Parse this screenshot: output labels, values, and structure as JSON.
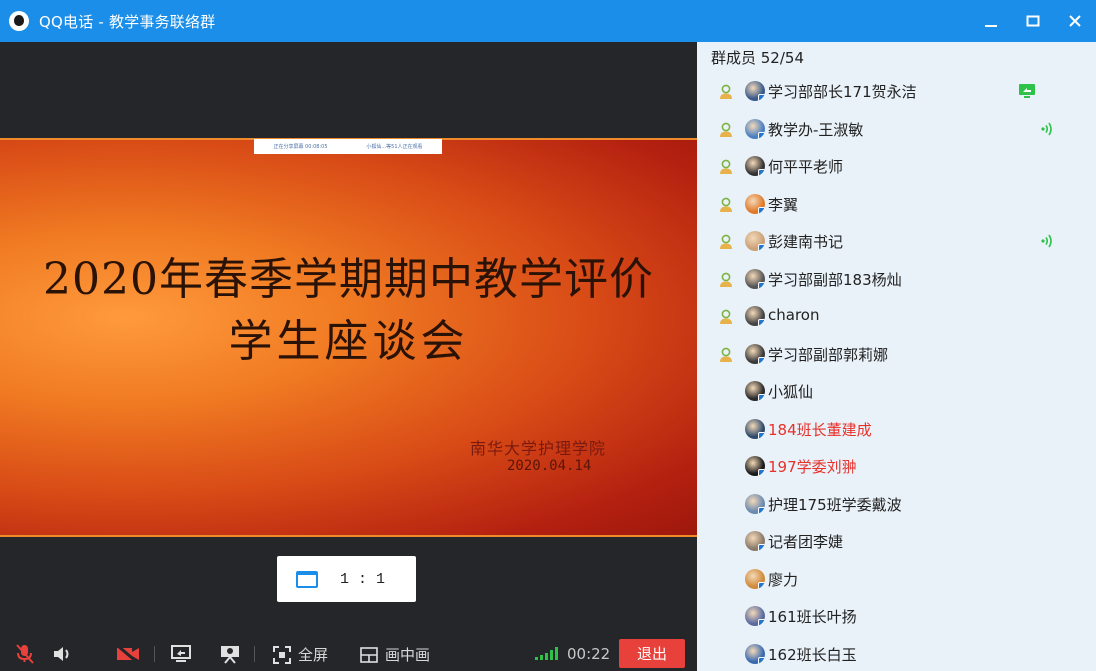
{
  "window": {
    "title": "QQ电话 - 教学事务联络群",
    "minimize_icon": "minimize-icon",
    "maximize_icon": "maximize-icon",
    "close_icon": "close-icon"
  },
  "slide": {
    "share_bar_left": "正在分享屏幕 00:08:05",
    "share_bar_right": "小狐仙...等51人正在观看",
    "title": "2020年春季学期期中教学评价",
    "subtitle": "学生座谈会",
    "org": "南华大学护理学院",
    "date": "2020.04.14"
  },
  "view_ratio": {
    "label": "1 : 1",
    "icon": "window-icon"
  },
  "controls": {
    "mic_icon": "mic-muted-icon",
    "speaker_icon": "speaker-icon",
    "camera_icon": "camera-off-icon",
    "share_screen_icon": "share-screen-icon",
    "presenter_icon": "presenter-icon",
    "fullscreen_label": "全屏",
    "pip_label": "画中画",
    "timer": "00:22",
    "exit_label": "退出",
    "signal_color": "#2fc24a"
  },
  "members": {
    "header": "群成员 52/54",
    "list": [
      {
        "name": "学习部部长171贺永洁",
        "red": false,
        "role_icon": true,
        "right_icon": "sharing-screen-icon",
        "avatar_color": "#3a5a8a"
      },
      {
        "name": "教学办-王淑敏",
        "red": false,
        "role_icon": true,
        "right_icon": "speaking-icon",
        "avatar_color": "#4a7fc0"
      },
      {
        "name": "何平平老师",
        "red": false,
        "role_icon": true,
        "right_icon": "",
        "avatar_color": "#333333"
      },
      {
        "name": "李翼",
        "red": false,
        "role_icon": true,
        "right_icon": "",
        "avatar_color": "#e07a2a"
      },
      {
        "name": "彭建南书记",
        "red": false,
        "role_icon": true,
        "right_icon": "speaking-icon",
        "avatar_color": "#caa27a"
      },
      {
        "name": "学习部副部183杨灿",
        "red": false,
        "role_icon": true,
        "right_icon": "",
        "avatar_color": "#555555"
      },
      {
        "name": "charon",
        "red": false,
        "role_icon": true,
        "right_icon": "",
        "avatar_color": "#444444"
      },
      {
        "name": "学习部副部郭莉娜",
        "red": false,
        "role_icon": true,
        "right_icon": "",
        "avatar_color": "#3a3a3a"
      },
      {
        "name": "小狐仙",
        "red": false,
        "role_icon": false,
        "right_icon": "",
        "avatar_color": "#2a2a2a"
      },
      {
        "name": "184班长董建成",
        "red": true,
        "role_icon": false,
        "right_icon": "",
        "avatar_color": "#2f4a6a"
      },
      {
        "name": "197学委刘翀",
        "red": true,
        "role_icon": false,
        "right_icon": "",
        "avatar_color": "#1a1a1a"
      },
      {
        "name": "护理175班学委戴波",
        "red": false,
        "role_icon": false,
        "right_icon": "",
        "avatar_color": "#6a8ab0"
      },
      {
        "name": "记者团李婕",
        "red": false,
        "role_icon": false,
        "right_icon": "",
        "avatar_color": "#8a7a6a"
      },
      {
        "name": "廖力",
        "red": false,
        "role_icon": false,
        "right_icon": "",
        "avatar_color": "#d08a3a"
      },
      {
        "name": "161班长叶扬",
        "red": false,
        "role_icon": false,
        "right_icon": "",
        "avatar_color": "#5a6aa0"
      },
      {
        "name": "162班长白玉",
        "red": false,
        "role_icon": false,
        "right_icon": "",
        "avatar_color": "#3a6ab0"
      }
    ]
  },
  "colors": {
    "titlebar": "#1a8ee8",
    "accent": "#1a8ee8",
    "exit": "#e8403a",
    "red_name": "#e8302a",
    "person_icon": "#7cb342"
  }
}
